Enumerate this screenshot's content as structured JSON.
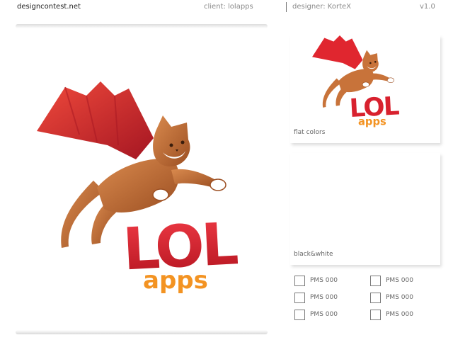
{
  "header": {
    "site": "designcontest.net",
    "client": "client: lolapps",
    "designer": "designer: KorteX",
    "version": "v1.0"
  },
  "logo": {
    "wordmark": "LOL",
    "tagline": "apps",
    "colors": {
      "red": "#d8212e",
      "orange": "#f39322",
      "cat": "#c8733a",
      "cape": "#e0262f"
    }
  },
  "variants": {
    "flat_label": "flat colors",
    "bw_label": "black&white"
  },
  "pms": [
    {
      "label": "PMS 000"
    },
    {
      "label": "PMS 000"
    },
    {
      "label": "PMS 000"
    },
    {
      "label": "PMS 000"
    },
    {
      "label": "PMS 000"
    },
    {
      "label": "PMS 000"
    }
  ]
}
